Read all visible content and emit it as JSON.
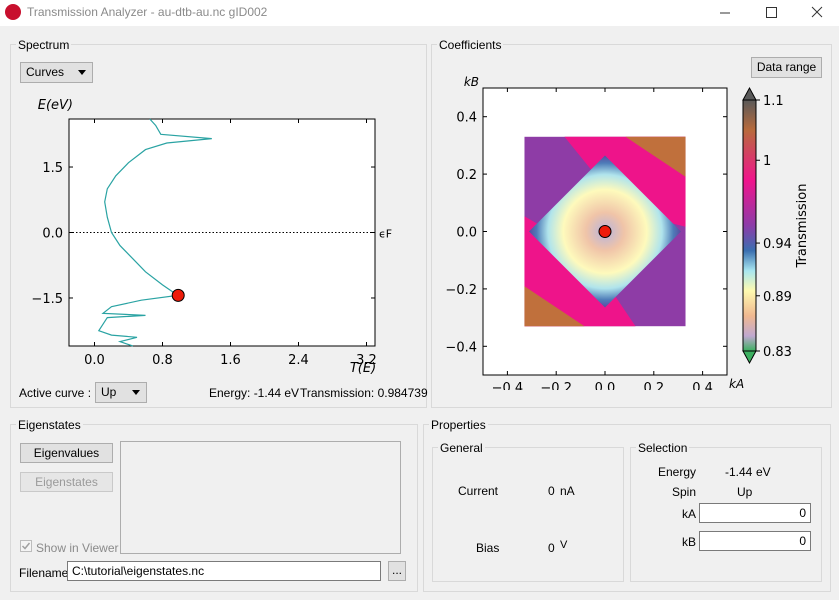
{
  "window": {
    "title": "Transmission Analyzer - au-dtb-au.nc gID002"
  },
  "spectrum": {
    "group_title": "Spectrum",
    "curves_label": "Curves",
    "active_curve_label": "Active curve :",
    "active_curve_value": "Up",
    "energy_text": "Energy: -1.44 eV",
    "transmission_text": "Transmission: 0.984739"
  },
  "coefficients": {
    "group_title": "Coefficients",
    "data_range_label": "Data range"
  },
  "eigenstates": {
    "group_title": "Eigenstates",
    "eigenvalues_label": "Eigenvalues",
    "eigenstates_label": "Eigenstates",
    "show_in_viewer_label": "Show in Viewer",
    "filename_label": "Filename",
    "filename_value": "C:\\tutorial\\eigenstates.nc",
    "browse_label": "..."
  },
  "properties": {
    "group_title": "Properties",
    "general_title": "General",
    "current_label": "Current",
    "current_value": "0",
    "current_unit": "nA",
    "bias_label": "Bias",
    "bias_value": "0",
    "bias_unit": "V",
    "selection_title": "Selection",
    "energy_label": "Energy",
    "energy_value": "-1.44",
    "energy_unit": "eV",
    "spin_label": "Spin",
    "spin_value": "Up",
    "ka_label": "kA",
    "ka_value": "0",
    "kb_label": "kB",
    "kb_value": "0"
  },
  "chart_data": [
    {
      "type": "line",
      "xlabel": "T(E)",
      "ylabel": "E(eV)",
      "xlim": [
        -0.3,
        3.3
      ],
      "ylim": [
        -2.6,
        2.6
      ],
      "xticks": [
        "0.0",
        "0.8",
        "1.6",
        "2.4",
        "3.2"
      ],
      "yticks": [
        "1.5",
        "0.0",
        "−1.5"
      ],
      "fermi_label": "ϵF",
      "series": [
        {
          "color": "#2aa3a3",
          "points": [
            [
              0.65,
              2.6
            ],
            [
              0.72,
              2.45
            ],
            [
              0.78,
              2.25
            ],
            [
              1.38,
              2.15
            ],
            [
              0.85,
              2.05
            ],
            [
              0.6,
              1.9
            ],
            [
              0.4,
              1.6
            ],
            [
              0.25,
              1.3
            ],
            [
              0.15,
              1.0
            ],
            [
              0.12,
              0.7
            ],
            [
              0.15,
              0.35
            ],
            [
              0.2,
              0.0
            ],
            [
              0.3,
              -0.3
            ],
            [
              0.45,
              -0.6
            ],
            [
              0.6,
              -0.9
            ],
            [
              0.8,
              -1.2
            ],
            [
              0.98,
              -1.44
            ],
            [
              0.55,
              -1.55
            ],
            [
              0.2,
              -1.7
            ],
            [
              0.1,
              -1.85
            ],
            [
              0.6,
              -1.9
            ],
            [
              0.15,
              -1.95
            ],
            [
              0.1,
              -2.1
            ],
            [
              0.05,
              -2.25
            ],
            [
              0.2,
              -2.35
            ],
            [
              0.5,
              -2.4
            ],
            [
              0.3,
              -2.5
            ],
            [
              0.45,
              -2.6
            ]
          ]
        }
      ],
      "marker": {
        "x": 0.984739,
        "y": -1.44,
        "color": "#ee1c0a"
      }
    },
    {
      "type": "heatmap",
      "xlabel": "kA",
      "ylabel": "kB",
      "xlim": [
        -0.5,
        0.5
      ],
      "ylim": [
        -0.5,
        0.5
      ],
      "xticks": [
        "−0.4",
        "−0.2",
        "0.0",
        "0.2",
        "0.4"
      ],
      "yticks": [
        "0.4",
        "0.2",
        "0.0",
        "−0.2",
        "−0.4"
      ],
      "data_extent": [
        -0.33,
        0.33
      ],
      "colorbar": {
        "label": "Transmission",
        "ticks": [
          "1.1",
          "1",
          "0.94",
          "0.89",
          "0.83"
        ]
      },
      "marker": {
        "x": 0.0,
        "y": 0.0,
        "color": "#ee1c0a"
      }
    }
  ]
}
